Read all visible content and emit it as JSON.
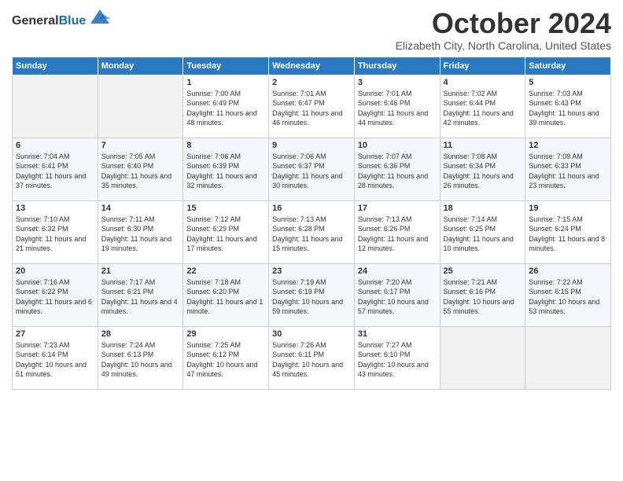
{
  "header": {
    "logo_general": "General",
    "logo_blue": "Blue",
    "month": "October 2024",
    "location": "Elizabeth City, North Carolina, United States"
  },
  "days_of_week": [
    "Sunday",
    "Monday",
    "Tuesday",
    "Wednesday",
    "Thursday",
    "Friday",
    "Saturday"
  ],
  "weeks": [
    [
      {
        "day": "",
        "info": ""
      },
      {
        "day": "",
        "info": ""
      },
      {
        "day": "1",
        "info": "Sunrise: 7:00 AM\nSunset: 6:49 PM\nDaylight: 11 hours and 48 minutes."
      },
      {
        "day": "2",
        "info": "Sunrise: 7:01 AM\nSunset: 6:47 PM\nDaylight: 11 hours and 46 minutes."
      },
      {
        "day": "3",
        "info": "Sunrise: 7:01 AM\nSunset: 6:46 PM\nDaylight: 11 hours and 44 minutes."
      },
      {
        "day": "4",
        "info": "Sunrise: 7:02 AM\nSunset: 6:44 PM\nDaylight: 11 hours and 42 minutes."
      },
      {
        "day": "5",
        "info": "Sunrise: 7:03 AM\nSunset: 6:43 PM\nDaylight: 11 hours and 39 minutes."
      }
    ],
    [
      {
        "day": "6",
        "info": "Sunrise: 7:04 AM\nSunset: 6:41 PM\nDaylight: 11 hours and 37 minutes."
      },
      {
        "day": "7",
        "info": "Sunrise: 7:05 AM\nSunset: 6:40 PM\nDaylight: 11 hours and 35 minutes."
      },
      {
        "day": "8",
        "info": "Sunrise: 7:06 AM\nSunset: 6:39 PM\nDaylight: 11 hours and 32 minutes."
      },
      {
        "day": "9",
        "info": "Sunrise: 7:06 AM\nSunset: 6:37 PM\nDaylight: 11 hours and 30 minutes."
      },
      {
        "day": "10",
        "info": "Sunrise: 7:07 AM\nSunset: 6:36 PM\nDaylight: 11 hours and 28 minutes."
      },
      {
        "day": "11",
        "info": "Sunrise: 7:08 AM\nSunset: 6:34 PM\nDaylight: 11 hours and 26 minutes."
      },
      {
        "day": "12",
        "info": "Sunrise: 7:09 AM\nSunset: 6:33 PM\nDaylight: 11 hours and 23 minutes."
      }
    ],
    [
      {
        "day": "13",
        "info": "Sunrise: 7:10 AM\nSunset: 6:32 PM\nDaylight: 11 hours and 21 minutes."
      },
      {
        "day": "14",
        "info": "Sunrise: 7:11 AM\nSunset: 6:30 PM\nDaylight: 11 hours and 19 minutes."
      },
      {
        "day": "15",
        "info": "Sunrise: 7:12 AM\nSunset: 6:29 PM\nDaylight: 11 hours and 17 minutes."
      },
      {
        "day": "16",
        "info": "Sunrise: 7:13 AM\nSunset: 6:28 PM\nDaylight: 11 hours and 15 minutes."
      },
      {
        "day": "17",
        "info": "Sunrise: 7:13 AM\nSunset: 6:26 PM\nDaylight: 11 hours and 12 minutes."
      },
      {
        "day": "18",
        "info": "Sunrise: 7:14 AM\nSunset: 6:25 PM\nDaylight: 11 hours and 10 minutes."
      },
      {
        "day": "19",
        "info": "Sunrise: 7:15 AM\nSunset: 6:24 PM\nDaylight: 11 hours and 8 minutes."
      }
    ],
    [
      {
        "day": "20",
        "info": "Sunrise: 7:16 AM\nSunset: 6:22 PM\nDaylight: 11 hours and 6 minutes."
      },
      {
        "day": "21",
        "info": "Sunrise: 7:17 AM\nSunset: 6:21 PM\nDaylight: 11 hours and 4 minutes."
      },
      {
        "day": "22",
        "info": "Sunrise: 7:18 AM\nSunset: 6:20 PM\nDaylight: 11 hours and 1 minute."
      },
      {
        "day": "23",
        "info": "Sunrise: 7:19 AM\nSunset: 6:19 PM\nDaylight: 10 hours and 59 minutes."
      },
      {
        "day": "24",
        "info": "Sunrise: 7:20 AM\nSunset: 6:17 PM\nDaylight: 10 hours and 57 minutes."
      },
      {
        "day": "25",
        "info": "Sunrise: 7:21 AM\nSunset: 6:16 PM\nDaylight: 10 hours and 55 minutes."
      },
      {
        "day": "26",
        "info": "Sunrise: 7:22 AM\nSunset: 6:15 PM\nDaylight: 10 hours and 53 minutes."
      }
    ],
    [
      {
        "day": "27",
        "info": "Sunrise: 7:23 AM\nSunset: 6:14 PM\nDaylight: 10 hours and 51 minutes."
      },
      {
        "day": "28",
        "info": "Sunrise: 7:24 AM\nSunset: 6:13 PM\nDaylight: 10 hours and 49 minutes."
      },
      {
        "day": "29",
        "info": "Sunrise: 7:25 AM\nSunset: 6:12 PM\nDaylight: 10 hours and 47 minutes."
      },
      {
        "day": "30",
        "info": "Sunrise: 7:26 AM\nSunset: 6:11 PM\nDaylight: 10 hours and 45 minutes."
      },
      {
        "day": "31",
        "info": "Sunrise: 7:27 AM\nSunset: 6:10 PM\nDaylight: 10 hours and 43 minutes."
      },
      {
        "day": "",
        "info": ""
      },
      {
        "day": "",
        "info": ""
      }
    ]
  ]
}
